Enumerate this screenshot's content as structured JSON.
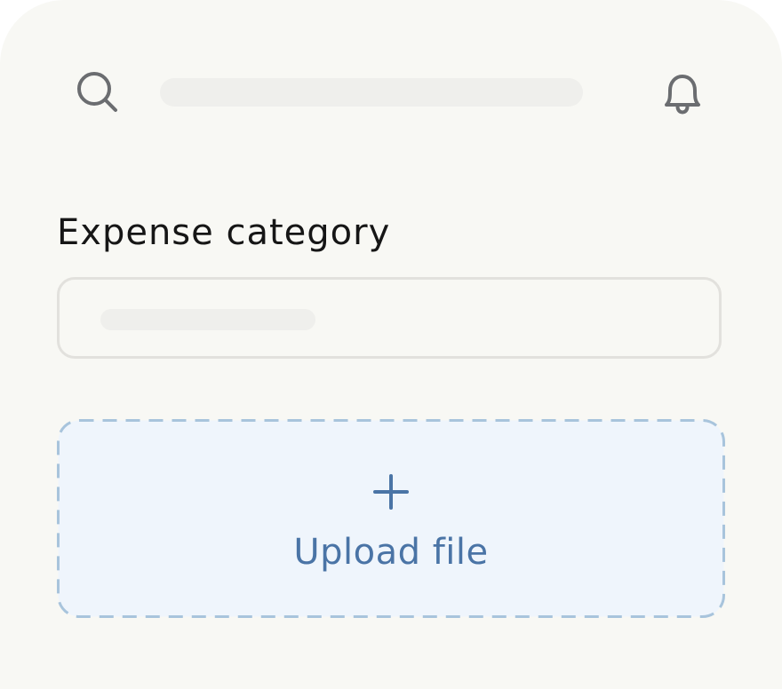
{
  "header": {
    "search_icon": "search-icon",
    "notification_icon": "bell-icon"
  },
  "form": {
    "category_label": "Expense category"
  },
  "upload": {
    "icon": "plus-icon",
    "label": "Upload file"
  },
  "colors": {
    "background": "#f8f8f4",
    "accent": "#4a74a6",
    "upload_fill": "#eff5fc",
    "upload_border": "#a8c4dc",
    "icon": "#6b6d70",
    "text": "#161616"
  }
}
